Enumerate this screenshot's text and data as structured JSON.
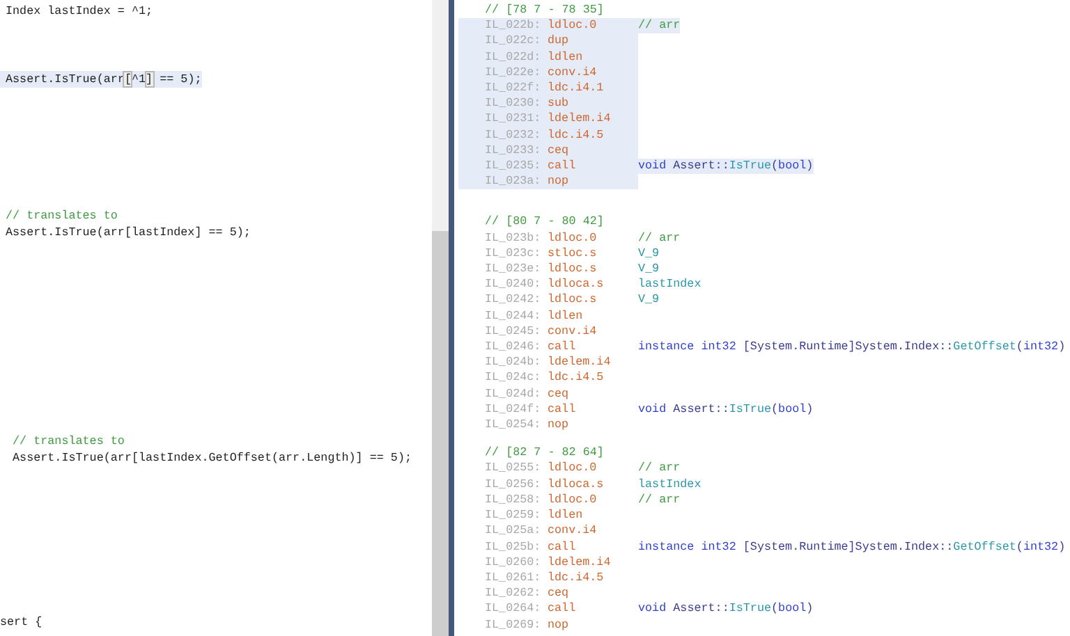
{
  "source_editor": {
    "blocks": [
      {
        "highlighted": false,
        "lines": [
          [
            {
              "text": "Index lastIndex = ^1;",
              "kind": "plain"
            }
          ]
        ]
      },
      {
        "highlighted": true,
        "lines": [
          [
            {
              "text": "Assert.IsTrue(arr",
              "kind": "plain"
            },
            {
              "text": "[",
              "kind": "brace"
            },
            {
              "text": "^1",
              "kind": "plain"
            },
            {
              "text": "]",
              "kind": "brace"
            },
            {
              "text": " == 5);",
              "kind": "plain"
            }
          ]
        ]
      },
      {
        "highlighted": false,
        "lines": [
          [
            {
              "text": "// translates to",
              "kind": "comment"
            }
          ],
          [
            {
              "text": "Assert.IsTrue(arr[lastIndex] == 5);",
              "kind": "plain"
            }
          ]
        ]
      },
      {
        "highlighted": false,
        "lines": [
          [
            {
              "text": " // translates to",
              "kind": "comment"
            }
          ],
          [
            {
              "text": " Assert.IsTrue(arr[lastIndex.GetOffset(arr.Length)] == 5);",
              "kind": "plain"
            }
          ]
        ]
      },
      {
        "highlighted": false,
        "lines": [
          [
            {
              "text": "sert {",
              "kind": "plain"
            }
          ]
        ]
      }
    ]
  },
  "il_view": {
    "groups": [
      {
        "highlighted": true,
        "header": "// [78 7 - 78 35]",
        "instructions": [
          {
            "address": "IL_022b:",
            "opcode": "ldloc.0",
            "operand": [
              {
                "text": "// arr",
                "kind": "comment"
              }
            ]
          },
          {
            "address": "IL_022c:",
            "opcode": "dup"
          },
          {
            "address": "IL_022d:",
            "opcode": "ldlen"
          },
          {
            "address": "IL_022e:",
            "opcode": "conv.i4"
          },
          {
            "address": "IL_022f:",
            "opcode": "ldc.i4.1"
          },
          {
            "address": "IL_0230:",
            "opcode": "sub"
          },
          {
            "address": "IL_0231:",
            "opcode": "ldelem.i4"
          },
          {
            "address": "IL_0232:",
            "opcode": "ldc.i4.5"
          },
          {
            "address": "IL_0233:",
            "opcode": "ceq"
          },
          {
            "address": "IL_0235:",
            "opcode": "call",
            "operand": [
              {
                "text": "void ",
                "kind": "keyword"
              },
              {
                "text": "Assert::",
                "kind": "type"
              },
              {
                "text": "IsTrue",
                "kind": "method"
              },
              {
                "text": "(",
                "kind": "type"
              },
              {
                "text": "bool",
                "kind": "keyword"
              },
              {
                "text": ")",
                "kind": "type"
              }
            ]
          },
          {
            "address": "IL_023a:",
            "opcode": "nop"
          }
        ]
      },
      {
        "highlighted": false,
        "header": "// [80 7 - 80 42]",
        "instructions": [
          {
            "address": "IL_023b:",
            "opcode": "ldloc.0",
            "operand": [
              {
                "text": "// arr",
                "kind": "comment"
              }
            ]
          },
          {
            "address": "IL_023c:",
            "opcode": "stloc.s",
            "operand": [
              {
                "text": "V_9",
                "kind": "local"
              }
            ]
          },
          {
            "address": "IL_023e:",
            "opcode": "ldloc.s",
            "operand": [
              {
                "text": "V_9",
                "kind": "local"
              }
            ]
          },
          {
            "address": "IL_0240:",
            "opcode": "ldloca.s",
            "operand": [
              {
                "text": "lastIndex",
                "kind": "local"
              }
            ]
          },
          {
            "address": "IL_0242:",
            "opcode": "ldloc.s",
            "operand": [
              {
                "text": "V_9",
                "kind": "local"
              }
            ]
          },
          {
            "address": "IL_0244:",
            "opcode": "ldlen"
          },
          {
            "address": "IL_0245:",
            "opcode": "conv.i4"
          },
          {
            "address": "IL_0246:",
            "opcode": "call",
            "operand": [
              {
                "text": "instance int32 ",
                "kind": "keyword"
              },
              {
                "text": "[System.Runtime]System.Index::",
                "kind": "type"
              },
              {
                "text": "GetOffset",
                "kind": "method"
              },
              {
                "text": "(",
                "kind": "type"
              },
              {
                "text": "int32",
                "kind": "keyword"
              },
              {
                "text": ")",
                "kind": "type"
              }
            ]
          },
          {
            "address": "IL_024b:",
            "opcode": "ldelem.i4"
          },
          {
            "address": "IL_024c:",
            "opcode": "ldc.i4.5"
          },
          {
            "address": "IL_024d:",
            "opcode": "ceq"
          },
          {
            "address": "IL_024f:",
            "opcode": "call",
            "operand": [
              {
                "text": "void ",
                "kind": "keyword"
              },
              {
                "text": "Assert::",
                "kind": "type"
              },
              {
                "text": "IsTrue",
                "kind": "method"
              },
              {
                "text": "(",
                "kind": "type"
              },
              {
                "text": "bool",
                "kind": "keyword"
              },
              {
                "text": ")",
                "kind": "type"
              }
            ]
          },
          {
            "address": "IL_0254:",
            "opcode": "nop"
          }
        ]
      },
      {
        "highlighted": false,
        "header": "// [82 7 - 82 64]",
        "instructions": [
          {
            "address": "IL_0255:",
            "opcode": "ldloc.0",
            "operand": [
              {
                "text": "// arr",
                "kind": "comment"
              }
            ]
          },
          {
            "address": "IL_0256:",
            "opcode": "ldloca.s",
            "operand": [
              {
                "text": "lastIndex",
                "kind": "local"
              }
            ]
          },
          {
            "address": "IL_0258:",
            "opcode": "ldloc.0",
            "operand": [
              {
                "text": "// arr",
                "kind": "comment"
              }
            ]
          },
          {
            "address": "IL_0259:",
            "opcode": "ldlen"
          },
          {
            "address": "IL_025a:",
            "opcode": "conv.i4"
          },
          {
            "address": "IL_025b:",
            "opcode": "call",
            "operand": [
              {
                "text": "instance int32 ",
                "kind": "keyword"
              },
              {
                "text": "[System.Runtime]System.Index::",
                "kind": "type"
              },
              {
                "text": "GetOffset",
                "kind": "method"
              },
              {
                "text": "(",
                "kind": "type"
              },
              {
                "text": "int32",
                "kind": "keyword"
              },
              {
                "text": ")",
                "kind": "type"
              }
            ]
          },
          {
            "address": "IL_0260:",
            "opcode": "ldelem.i4"
          },
          {
            "address": "IL_0261:",
            "opcode": "ldc.i4.5"
          },
          {
            "address": "IL_0262:",
            "opcode": "ceq"
          },
          {
            "address": "IL_0264:",
            "opcode": "call",
            "operand": [
              {
                "text": "void ",
                "kind": "keyword"
              },
              {
                "text": "Assert::",
                "kind": "type"
              },
              {
                "text": "IsTrue",
                "kind": "method"
              },
              {
                "text": "(",
                "kind": "type"
              },
              {
                "text": "bool",
                "kind": "keyword"
              },
              {
                "text": ")",
                "kind": "type"
              }
            ]
          },
          {
            "address": "IL_0269:",
            "opcode": "nop"
          }
        ]
      }
    ]
  }
}
